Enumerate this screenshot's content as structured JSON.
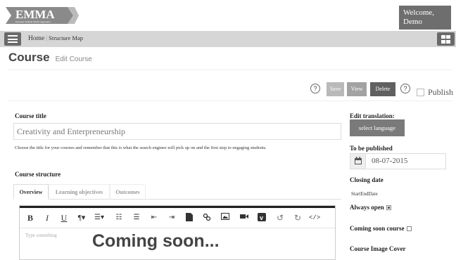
{
  "header": {
    "logo_text": "EMMA",
    "logo_tagline": "European Multiple MOOC Aggregator",
    "welcome_line1": "Welcome,",
    "welcome_line2": "Demo"
  },
  "breadcrumb": {
    "home": "Home",
    "separator": "|",
    "current": "Structure Map"
  },
  "page": {
    "title": "Course",
    "subtitle": "Edit Course"
  },
  "actions": {
    "help_glyph": "?",
    "save": "Save",
    "view": "View",
    "delete": "Delete",
    "publish": "Publish"
  },
  "course": {
    "title_label": "Course title",
    "title_value": "Creativity and Enterpreneurship",
    "title_hint": "Choose the title for your courses and remember that this is what the search engines will pick up on and the first step to engaging students.",
    "structure_label": "Course structure",
    "tabs": [
      {
        "label": "Overview"
      },
      {
        "label": "Learning objectives"
      },
      {
        "label": "Outcomes"
      }
    ],
    "editor_placeholder": "Type something",
    "editor_overlay": "Coming soon..."
  },
  "sidebar": {
    "translation_label": "Edit translation:",
    "language_button": "select language",
    "publish_date_label": "To be published",
    "publish_date": "08-07-2015",
    "closing_label": "Closing date",
    "closing_value": "StartEndDate",
    "always_open_label": "Always open",
    "always_open_checked": true,
    "coming_soon_label": "Coming soon course",
    "coming_soon_checked": false,
    "image_cover_label": "Course Image Cover"
  },
  "colors": {
    "nav_bg": "#d6d6d6",
    "dark_button": "#606060",
    "welcome_bg": "#6e6e6e"
  }
}
